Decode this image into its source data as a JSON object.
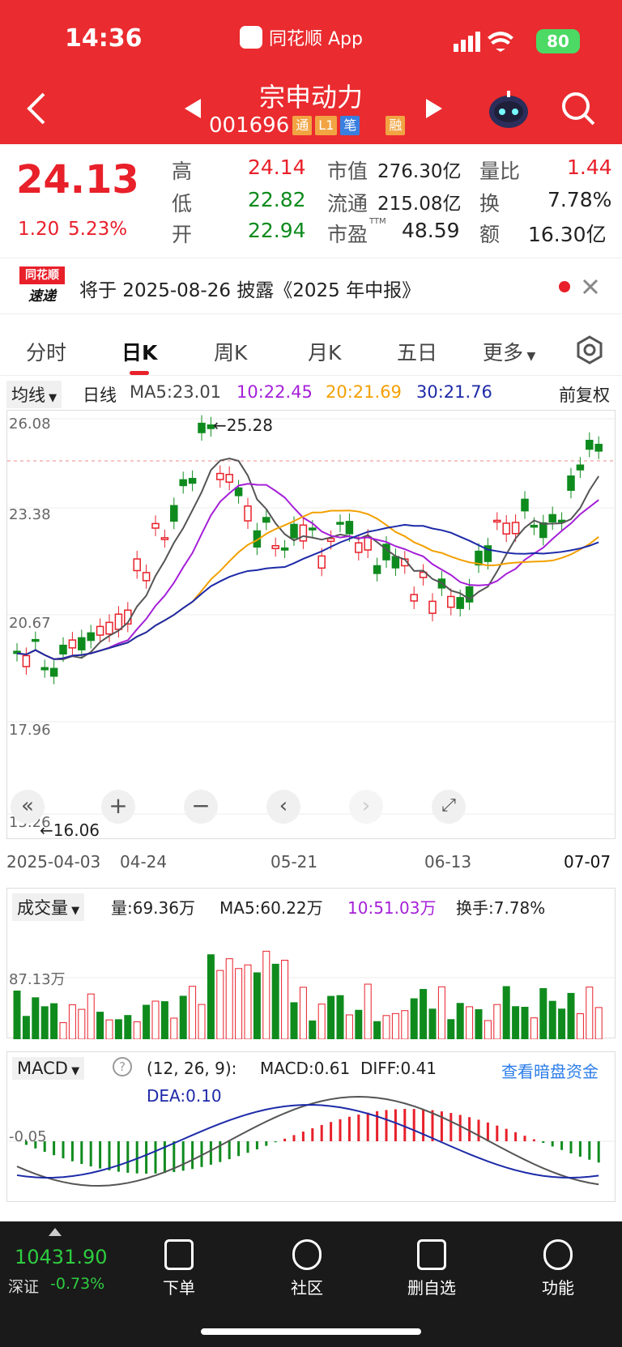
{
  "status": {
    "time": "14:36",
    "app": "同花顺 App",
    "battery": "80"
  },
  "header": {
    "name": "宗申动力",
    "code": "001696",
    "tags": [
      "通",
      "L1",
      "笔",
      "融"
    ]
  },
  "quote": {
    "price": "24.13",
    "change": "1.20",
    "pct": "5.23%",
    "high_l": "高",
    "high": "24.14",
    "low_l": "低",
    "low": "22.82",
    "open_l": "开",
    "open": "22.94",
    "mcap_l": "市值",
    "mcap": "276.30亿",
    "float_l": "流通",
    "float": "215.08亿",
    "pe_l": "市盈",
    "pe_sup": "TTM",
    "pe": "48.59",
    "vr_l": "量比",
    "vr": "1.44",
    "turn_l": "换",
    "turn": "7.78%",
    "amt_l": "额",
    "amt": "16.30亿"
  },
  "news": {
    "logo_top": "同花顺",
    "logo_bottom": "速递",
    "text": "将于 2025-08-26 披露《2025 年中报》"
  },
  "tabs": [
    "分时",
    "日K",
    "周K",
    "月K",
    "五日",
    "更多"
  ],
  "ma": {
    "select": "均线",
    "period": "日线",
    "ma5": "MA5:23.01",
    "ma10": "10:22.45",
    "ma20": "20:21.69",
    "ma30": "30:21.76",
    "adjust": "前复权"
  },
  "kchart": {
    "ylabels": [
      "26.08",
      "23.38",
      "20.67",
      "17.96",
      "15.26"
    ],
    "hi": "←25.28",
    "lo": "←16.06",
    "dates": [
      "2025-04-03",
      "04-24",
      "05-21",
      "06-13",
      "07-07"
    ]
  },
  "volume": {
    "select": "成交量",
    "vol": "量:69.36万",
    "ma5": "MA5:60.22万",
    "ma10": "10:51.03万",
    "turn": "换手:7.78%",
    "level": "87.13万"
  },
  "macd": {
    "select": "MACD",
    "params": "(12, 26, 9):",
    "macd": "MACD:0.61",
    "diff": "DIFF:0.41",
    "dea": "DEA:0.10",
    "link": "查看暗盘资金",
    "level": "-0.05"
  },
  "bottom": {
    "index": "10431.90",
    "index_name": "深证",
    "index_pct": "-0.73%",
    "nav": [
      "下单",
      "社区",
      "删自选",
      "功能"
    ]
  },
  "colors": {
    "up": "#e8202a",
    "down": "#0f8b1e",
    "header": "#ea2b2f"
  }
}
